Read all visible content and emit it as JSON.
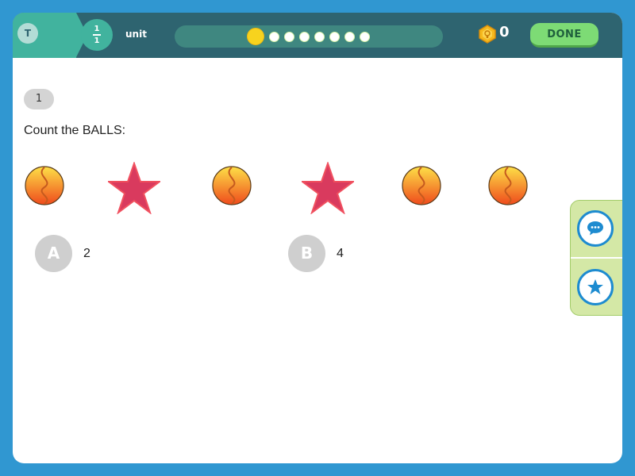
{
  "header": {
    "user_initial": "T",
    "fraction": {
      "numerator": "1",
      "denominator": "1"
    },
    "unit_label": "unit",
    "progress": {
      "current": 1,
      "total": 8
    },
    "coin_count": "0",
    "done_label": "DONE"
  },
  "question": {
    "number": "1",
    "prompt": "Count the BALLS:",
    "items": [
      {
        "kind": "ball-icon"
      },
      {
        "kind": "star-icon"
      },
      {
        "kind": "ball-icon"
      },
      {
        "kind": "star-icon"
      },
      {
        "kind": "ball-icon"
      },
      {
        "kind": "ball-icon"
      }
    ]
  },
  "choices": [
    {
      "letter": "A",
      "value": "2"
    },
    {
      "letter": "B",
      "value": "4"
    }
  ],
  "side_tools": [
    {
      "icon": "chat-icon"
    },
    {
      "icon": "star-icon"
    }
  ],
  "colors": {
    "background": "#3097d1",
    "header": "#2e6470",
    "accent": "#41b39e",
    "done": "#7ddb75",
    "star": "#d93a5e",
    "ball_top": "#fde047",
    "ball_bottom": "#ef4a1c"
  }
}
